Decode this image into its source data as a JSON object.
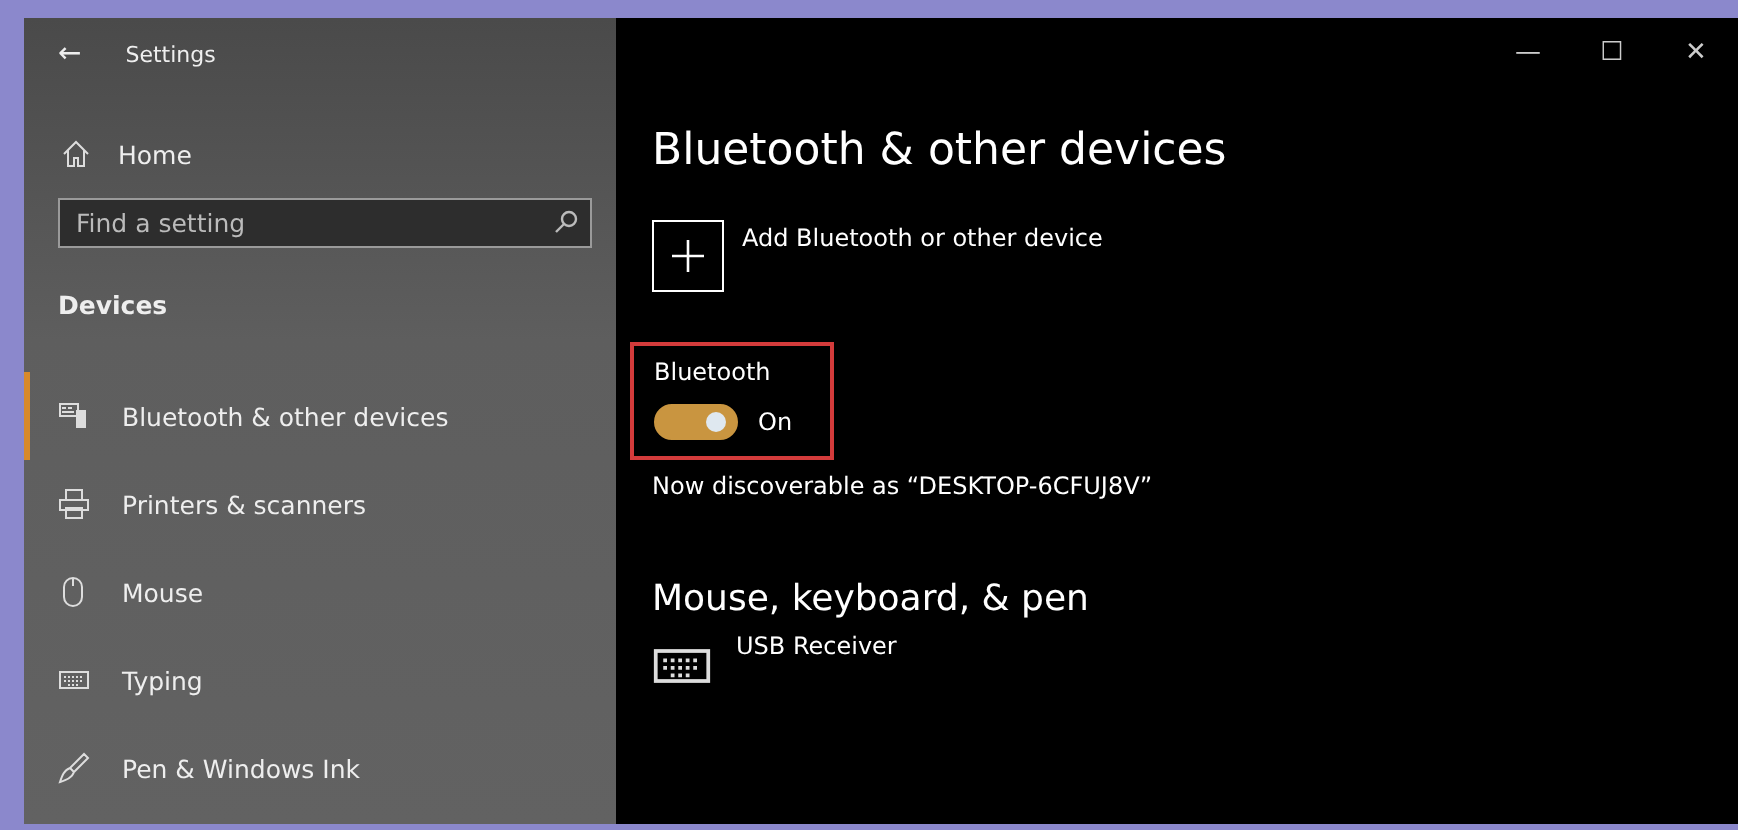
{
  "window": {
    "title": "Settings",
    "back": "←",
    "controls": [
      "—",
      "☐",
      "✕"
    ]
  },
  "sidebar": {
    "home": "Home",
    "search": {
      "placeholder": "Find a setting"
    },
    "section": "Devices",
    "items": [
      {
        "label": "Bluetooth & other devices",
        "kind": "bluetooth",
        "selected": true
      },
      {
        "label": "Printers & scanners",
        "kind": "printer",
        "selected": false
      },
      {
        "label": "Mouse",
        "kind": "mouse",
        "selected": false
      },
      {
        "label": "Typing",
        "kind": "keyboard",
        "selected": false
      },
      {
        "label": "Pen & Windows Ink",
        "kind": "pen",
        "selected": false
      }
    ]
  },
  "main": {
    "title": "Bluetooth & other devices",
    "add_device": "Add Bluetooth or other device",
    "bluetooth": {
      "label": "Bluetooth",
      "on": true,
      "state_text": "On",
      "highlighted": true
    },
    "discoverable": "Now discoverable as “DESKTOP-6CFUJ8V”",
    "section": "Mouse, keyboard, & pen",
    "devices": [
      {
        "name": "USB Receiver",
        "kind": "keyboard"
      }
    ]
  }
}
